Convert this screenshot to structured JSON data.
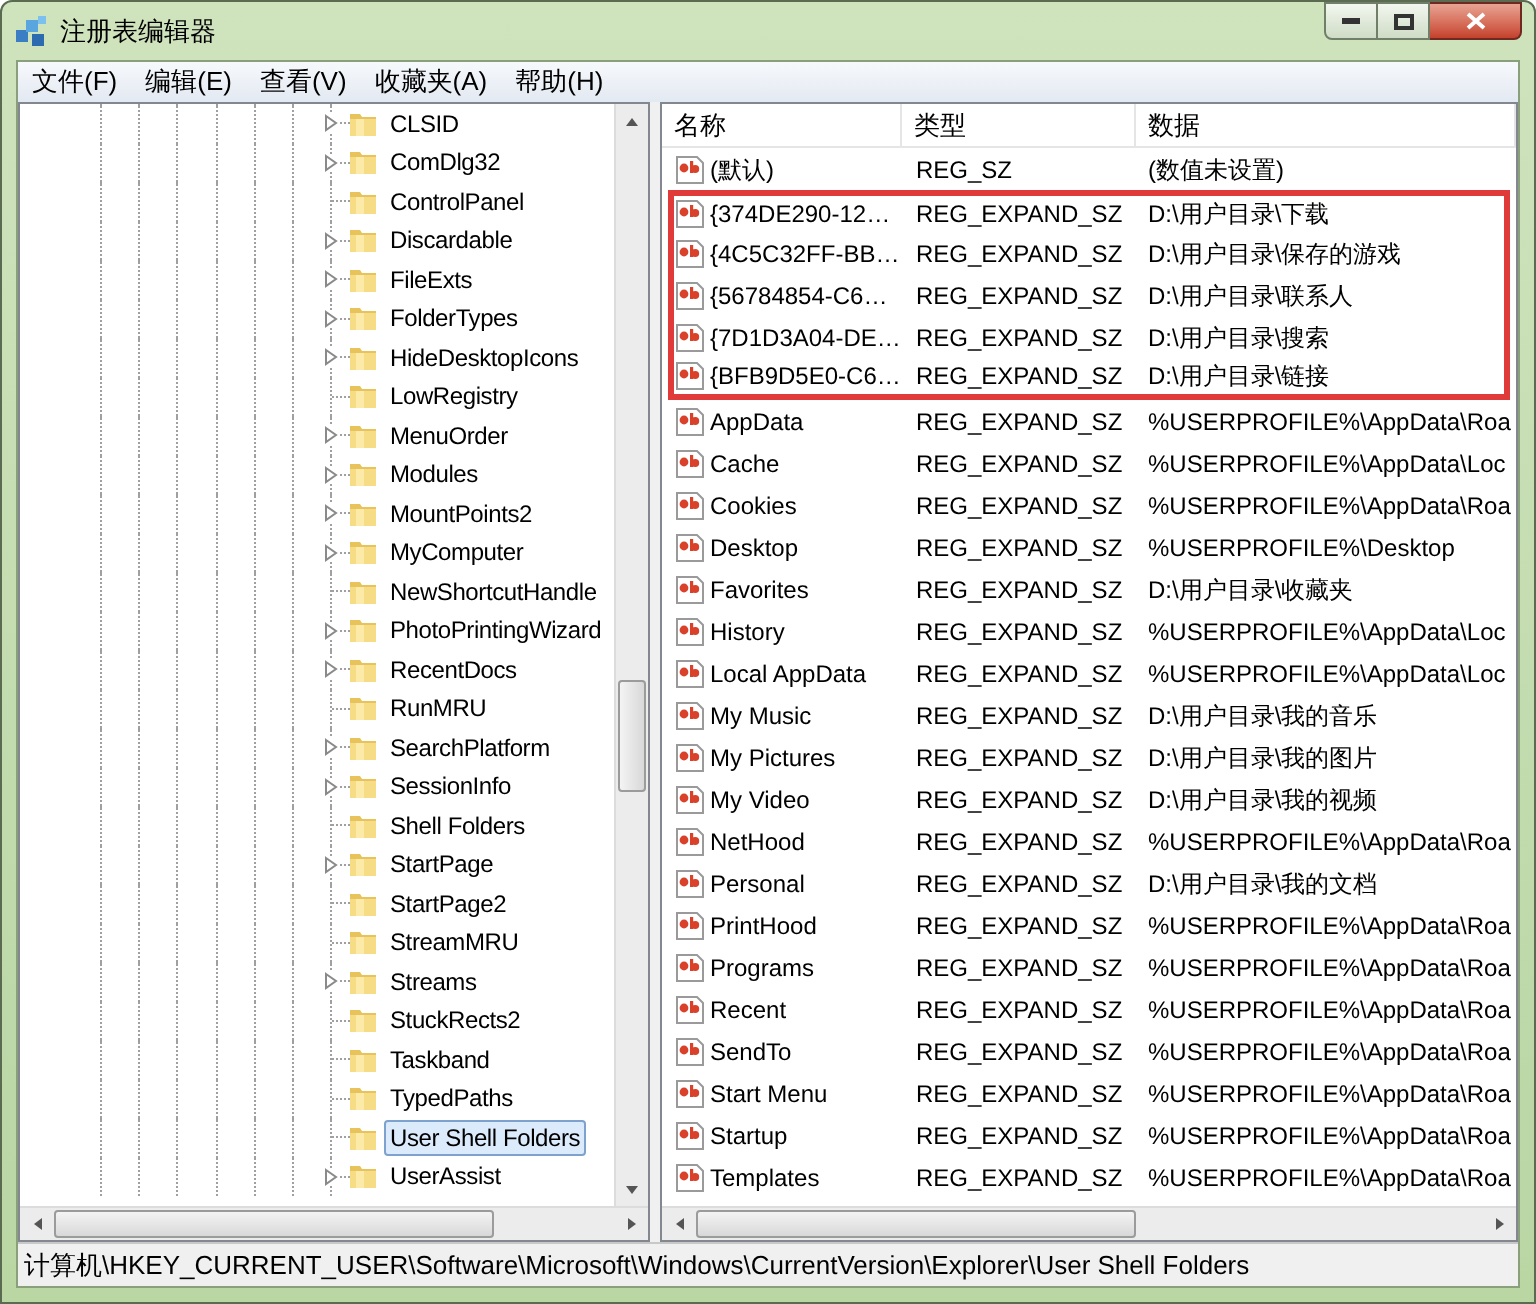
{
  "window": {
    "title": "注册表编辑器"
  },
  "menu": [
    "文件(F)",
    "编辑(E)",
    "查看(V)",
    "收藏夹(A)",
    "帮助(H)"
  ],
  "tree": {
    "items": [
      {
        "label": "CLSID",
        "expandable": true,
        "selected": false
      },
      {
        "label": "ComDlg32",
        "expandable": true,
        "selected": false
      },
      {
        "label": "ControlPanel",
        "expandable": false,
        "selected": false
      },
      {
        "label": "Discardable",
        "expandable": true,
        "selected": false
      },
      {
        "label": "FileExts",
        "expandable": true,
        "selected": false
      },
      {
        "label": "FolderTypes",
        "expandable": true,
        "selected": false
      },
      {
        "label": "HideDesktopIcons",
        "expandable": true,
        "selected": false
      },
      {
        "label": "LowRegistry",
        "expandable": false,
        "selected": false
      },
      {
        "label": "MenuOrder",
        "expandable": true,
        "selected": false
      },
      {
        "label": "Modules",
        "expandable": true,
        "selected": false
      },
      {
        "label": "MountPoints2",
        "expandable": true,
        "selected": false
      },
      {
        "label": "MyComputer",
        "expandable": true,
        "selected": false
      },
      {
        "label": "NewShortcutHandle",
        "expandable": false,
        "selected": false
      },
      {
        "label": "PhotoPrintingWizard",
        "expandable": true,
        "selected": false
      },
      {
        "label": "RecentDocs",
        "expandable": true,
        "selected": false
      },
      {
        "label": "RunMRU",
        "expandable": false,
        "selected": false
      },
      {
        "label": "SearchPlatform",
        "expandable": true,
        "selected": false
      },
      {
        "label": "SessionInfo",
        "expandable": true,
        "selected": false
      },
      {
        "label": "Shell Folders",
        "expandable": false,
        "selected": false
      },
      {
        "label": "StartPage",
        "expandable": true,
        "selected": false
      },
      {
        "label": "StartPage2",
        "expandable": false,
        "selected": false
      },
      {
        "label": "StreamMRU",
        "expandable": false,
        "selected": false
      },
      {
        "label": "Streams",
        "expandable": true,
        "selected": false
      },
      {
        "label": "StuckRects2",
        "expandable": false,
        "selected": false
      },
      {
        "label": "Taskband",
        "expandable": false,
        "selected": false
      },
      {
        "label": "TypedPaths",
        "expandable": false,
        "selected": false
      },
      {
        "label": "User Shell Folders",
        "expandable": false,
        "selected": true
      },
      {
        "label": "UserAssist",
        "expandable": true,
        "selected": false
      }
    ]
  },
  "values": {
    "columns": [
      "名称",
      "类型",
      "数据"
    ],
    "rows": [
      {
        "name": "(默认)",
        "type": "REG_SZ",
        "data": "(数值未设置)",
        "highlighted": false
      },
      {
        "name": "{374DE290-12…",
        "type": "REG_EXPAND_SZ",
        "data": "D:\\用户目录\\下载",
        "highlighted": true
      },
      {
        "name": "{4C5C32FF-BB…",
        "type": "REG_EXPAND_SZ",
        "data": "D:\\用户目录\\保存的游戏",
        "highlighted": true
      },
      {
        "name": "{56784854-C6…",
        "type": "REG_EXPAND_SZ",
        "data": "D:\\用户目录\\联系人",
        "highlighted": true
      },
      {
        "name": "{7D1D3A04-DE…",
        "type": "REG_EXPAND_SZ",
        "data": "D:\\用户目录\\搜索",
        "highlighted": true
      },
      {
        "name": "{BFB9D5E0-C6…",
        "type": "REG_EXPAND_SZ",
        "data": "D:\\用户目录\\链接",
        "highlighted": true
      },
      {
        "name": "AppData",
        "type": "REG_EXPAND_SZ",
        "data": "%USERPROFILE%\\AppData\\Roa",
        "highlighted": false
      },
      {
        "name": "Cache",
        "type": "REG_EXPAND_SZ",
        "data": "%USERPROFILE%\\AppData\\Loc",
        "highlighted": false
      },
      {
        "name": "Cookies",
        "type": "REG_EXPAND_SZ",
        "data": "%USERPROFILE%\\AppData\\Roa",
        "highlighted": false
      },
      {
        "name": "Desktop",
        "type": "REG_EXPAND_SZ",
        "data": "%USERPROFILE%\\Desktop",
        "highlighted": false
      },
      {
        "name": "Favorites",
        "type": "REG_EXPAND_SZ",
        "data": "D:\\用户目录\\收藏夹",
        "highlighted": false
      },
      {
        "name": "History",
        "type": "REG_EXPAND_SZ",
        "data": "%USERPROFILE%\\AppData\\Loc",
        "highlighted": false
      },
      {
        "name": "Local AppData",
        "type": "REG_EXPAND_SZ",
        "data": "%USERPROFILE%\\AppData\\Loc",
        "highlighted": false
      },
      {
        "name": "My Music",
        "type": "REG_EXPAND_SZ",
        "data": "D:\\用户目录\\我的音乐",
        "highlighted": false
      },
      {
        "name": "My Pictures",
        "type": "REG_EXPAND_SZ",
        "data": "D:\\用户目录\\我的图片",
        "highlighted": false
      },
      {
        "name": "My Video",
        "type": "REG_EXPAND_SZ",
        "data": "D:\\用户目录\\我的视频",
        "highlighted": false
      },
      {
        "name": "NetHood",
        "type": "REG_EXPAND_SZ",
        "data": "%USERPROFILE%\\AppData\\Roa",
        "highlighted": false
      },
      {
        "name": "Personal",
        "type": "REG_EXPAND_SZ",
        "data": "D:\\用户目录\\我的文档",
        "highlighted": false
      },
      {
        "name": "PrintHood",
        "type": "REG_EXPAND_SZ",
        "data": "%USERPROFILE%\\AppData\\Roa",
        "highlighted": false
      },
      {
        "name": "Programs",
        "type": "REG_EXPAND_SZ",
        "data": "%USERPROFILE%\\AppData\\Roa",
        "highlighted": false
      },
      {
        "name": "Recent",
        "type": "REG_EXPAND_SZ",
        "data": "%USERPROFILE%\\AppData\\Roa",
        "highlighted": false
      },
      {
        "name": "SendTo",
        "type": "REG_EXPAND_SZ",
        "data": "%USERPROFILE%\\AppData\\Roa",
        "highlighted": false
      },
      {
        "name": "Start Menu",
        "type": "REG_EXPAND_SZ",
        "data": "%USERPROFILE%\\AppData\\Roa",
        "highlighted": false
      },
      {
        "name": "Startup",
        "type": "REG_EXPAND_SZ",
        "data": "%USERPROFILE%\\AppData\\Roa",
        "highlighted": false
      },
      {
        "name": "Templates",
        "type": "REG_EXPAND_SZ",
        "data": "%USERPROFILE%\\AppData\\Roa",
        "highlighted": false
      }
    ]
  },
  "status_bar": "计算机\\HKEY_CURRENT_USER\\Software\\Microsoft\\Windows\\CurrentVersion\\Explorer\\User Shell Folders"
}
